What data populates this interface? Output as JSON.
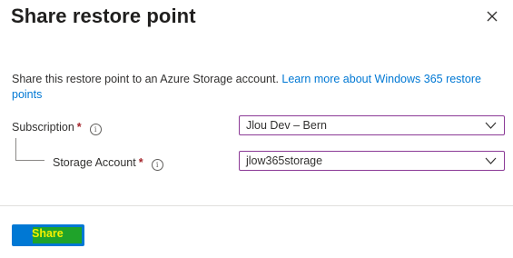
{
  "dialog": {
    "title": "Share restore point",
    "close_icon": "close-icon"
  },
  "description": {
    "text": "Share this restore point to an Azure Storage account. ",
    "link_text": "Learn more about Windows 365 restore points"
  },
  "fields": {
    "subscription": {
      "label": "Subscription",
      "required_mark": "*",
      "info_icon": "info-icon",
      "value": "Jlou Dev – Bern"
    },
    "storage_account": {
      "label": "Storage Account",
      "required_mark": "*",
      "info_icon": "info-icon",
      "value": "jlow365storage"
    }
  },
  "footer": {
    "share_label": "Share"
  },
  "colors": {
    "accent": "#0078d4",
    "select_border": "#8b3a96",
    "required": "#a4262c",
    "button_highlight": "#1fa32a",
    "button_text": "#f5f000"
  }
}
